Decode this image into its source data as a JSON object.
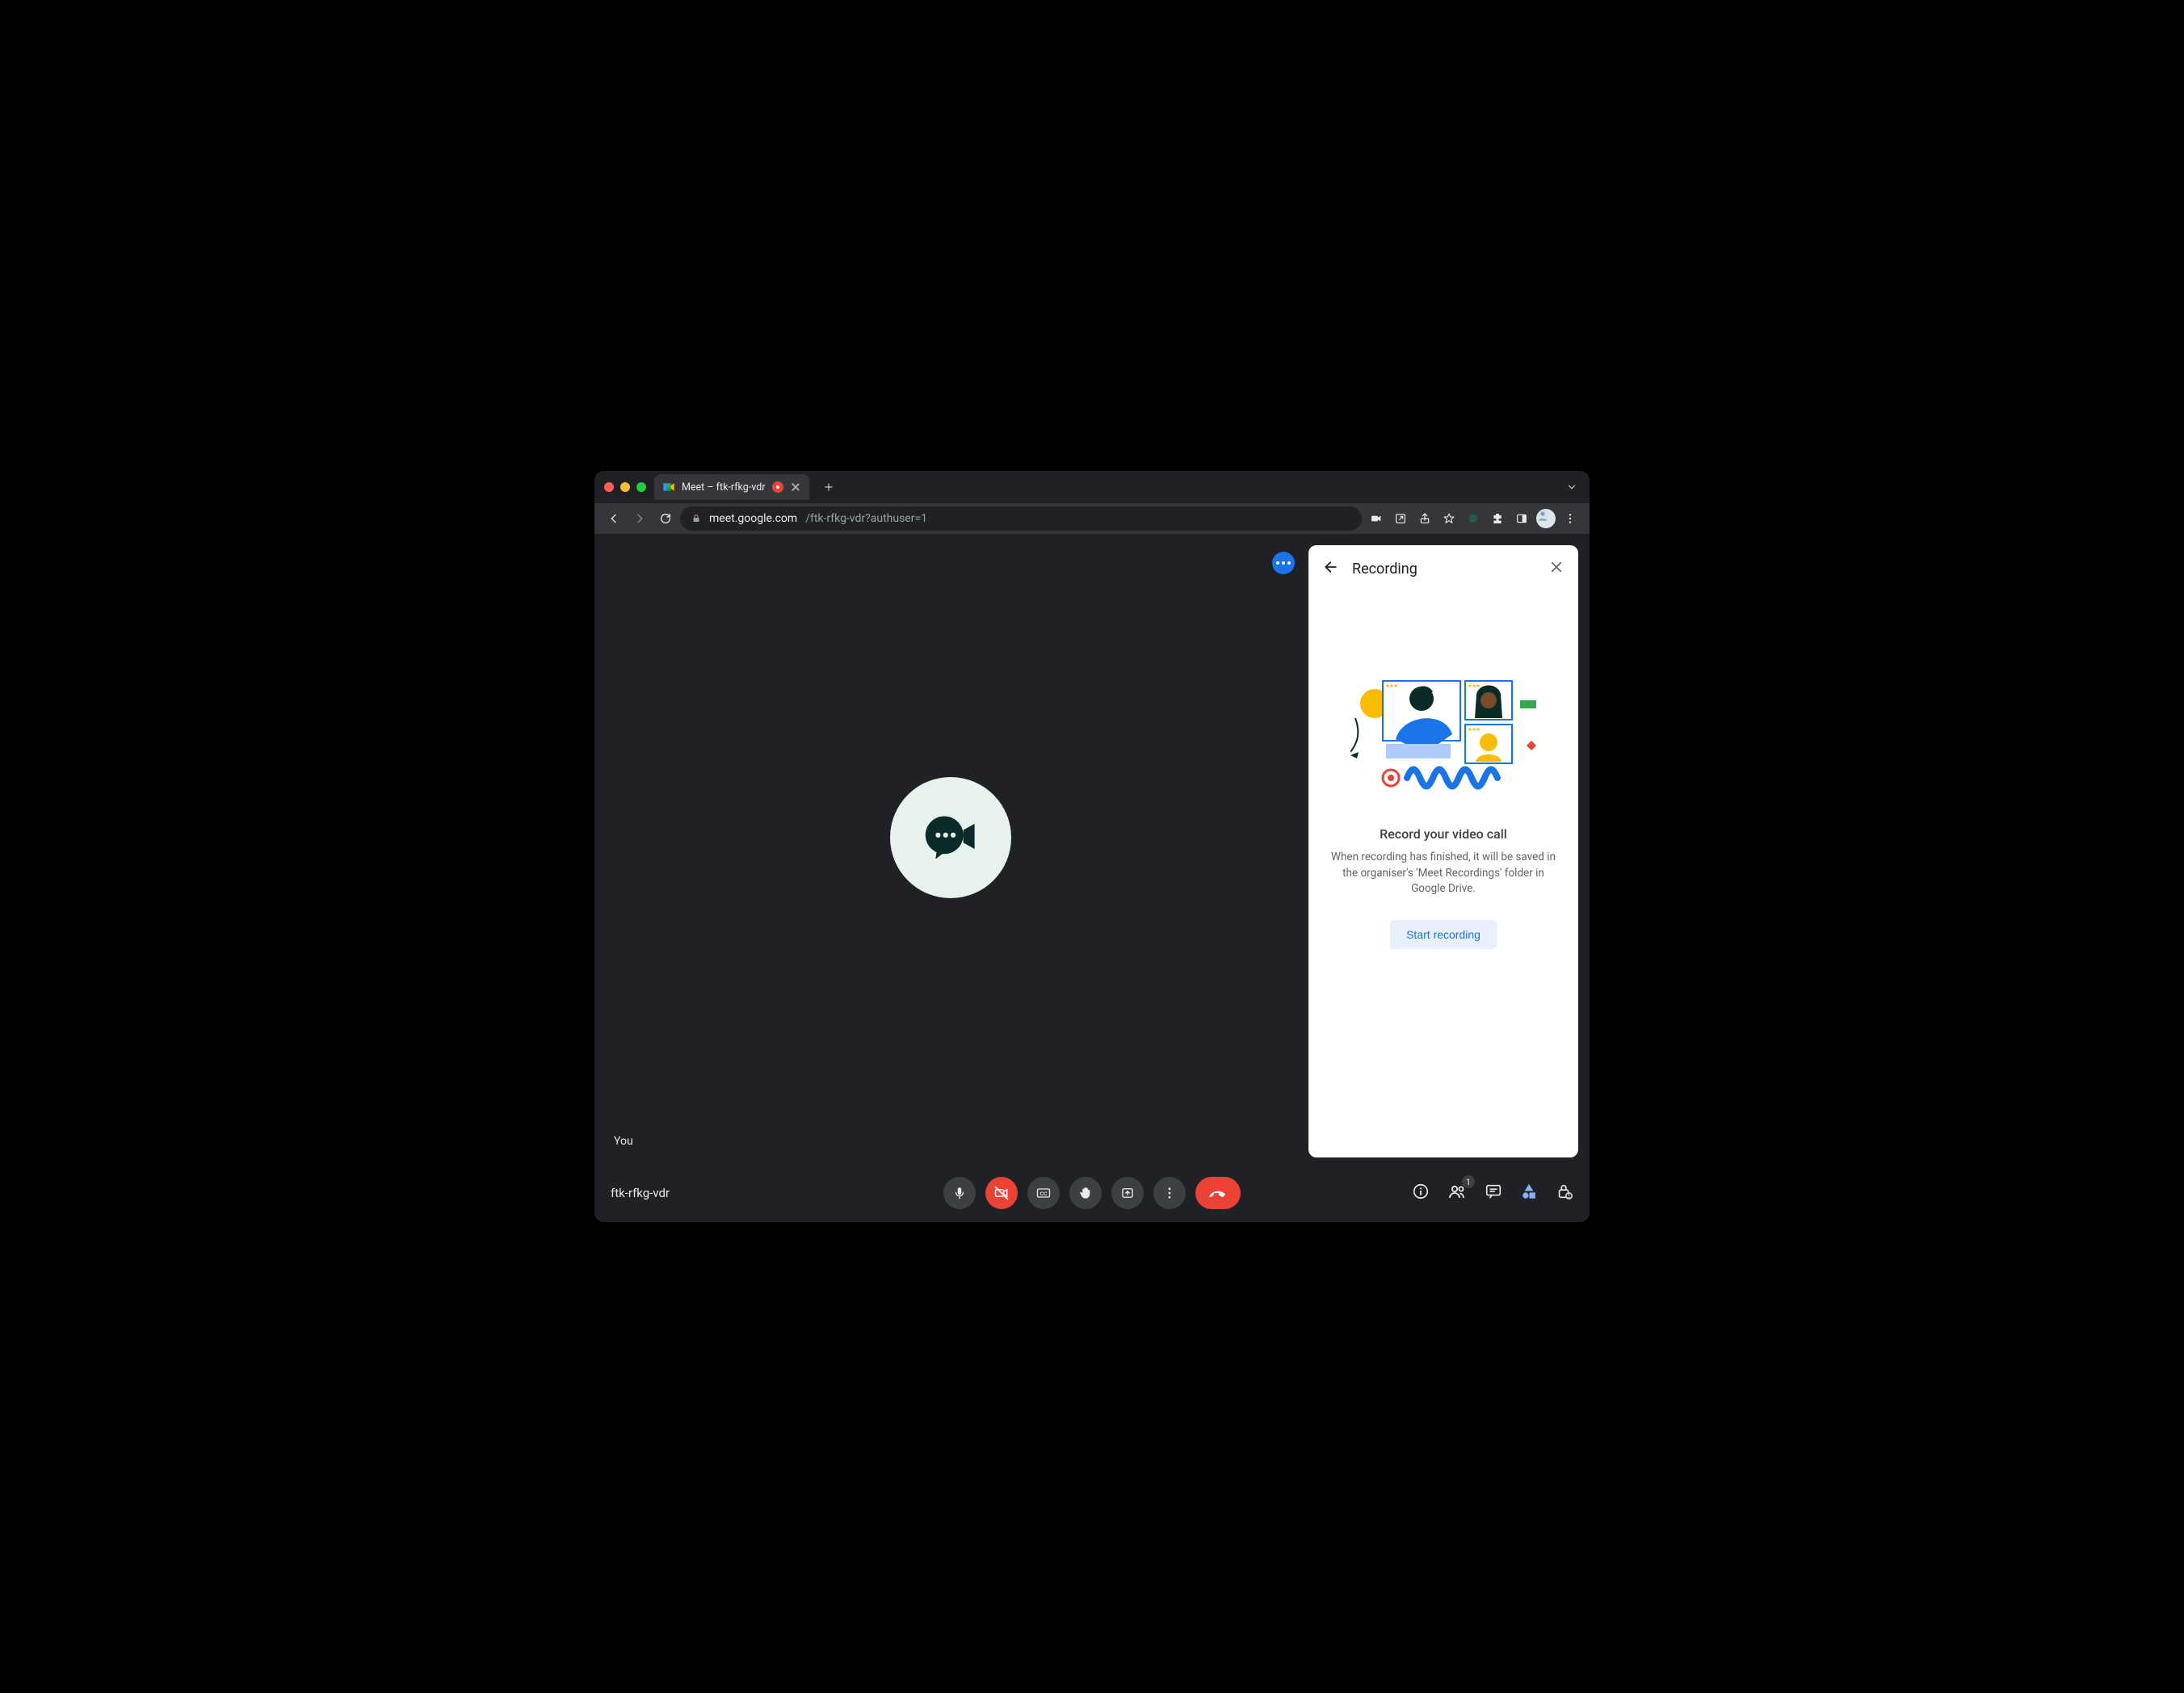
{
  "browser": {
    "tab_title": "Meet – ftk-rfkg-vdr",
    "url_host": "meet.google.com",
    "url_path": "/ftk-rfkg-vdr?authuser=1"
  },
  "video": {
    "self_label": "You"
  },
  "panel": {
    "title": "Recording",
    "heading": "Record your video call",
    "description": "When recording has finished, it will be saved in the organiser's 'Meet Recordings' folder in Google Drive.",
    "cta": "Start recording"
  },
  "bottom": {
    "meeting_code": "ftk-rfkg-vdr",
    "participants_count": "1"
  }
}
